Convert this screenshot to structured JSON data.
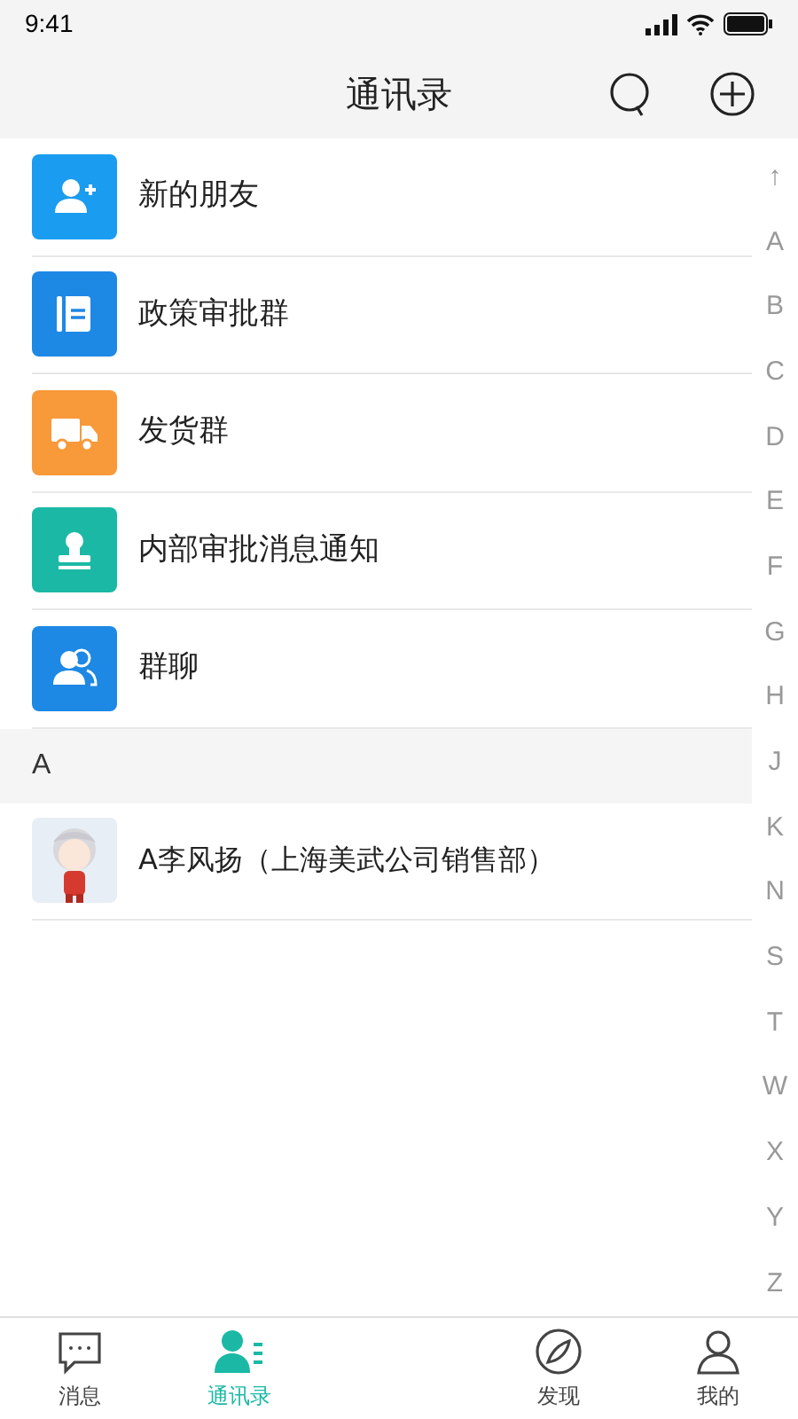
{
  "status_bar": {
    "time": "9:41"
  },
  "header": {
    "title": "通讯录"
  },
  "entries": [
    {
      "kind": "add-person",
      "label": "新的朋友",
      "color": "#1a9cf0"
    },
    {
      "kind": "notebook",
      "label": "政策审批群",
      "color": "#1e88e5"
    },
    {
      "kind": "truck",
      "label": "发货群",
      "color": "#f8993a"
    },
    {
      "kind": "stamp",
      "label": "内部审批消息通知",
      "color": "#1bb9a5"
    },
    {
      "kind": "group",
      "label": "群聊",
      "color": "#1e88e5"
    }
  ],
  "sections": [
    {
      "letter": "A",
      "contacts": [
        {
          "name": "A李风扬（上海美武公司销售部）"
        }
      ]
    }
  ],
  "index": [
    "↑",
    "A",
    "B",
    "C",
    "D",
    "E",
    "F",
    "G",
    "H",
    "J",
    "K",
    "N",
    "S",
    "T",
    "W",
    "X",
    "Y",
    "Z"
  ],
  "tabs": [
    {
      "kind": "chat",
      "label": "消息",
      "selected": false
    },
    {
      "kind": "contacts",
      "label": "通讯录",
      "selected": true
    },
    {
      "kind": "empty"
    },
    {
      "kind": "discover",
      "label": "发现",
      "selected": false
    },
    {
      "kind": "me",
      "label": "我的",
      "selected": false
    }
  ]
}
